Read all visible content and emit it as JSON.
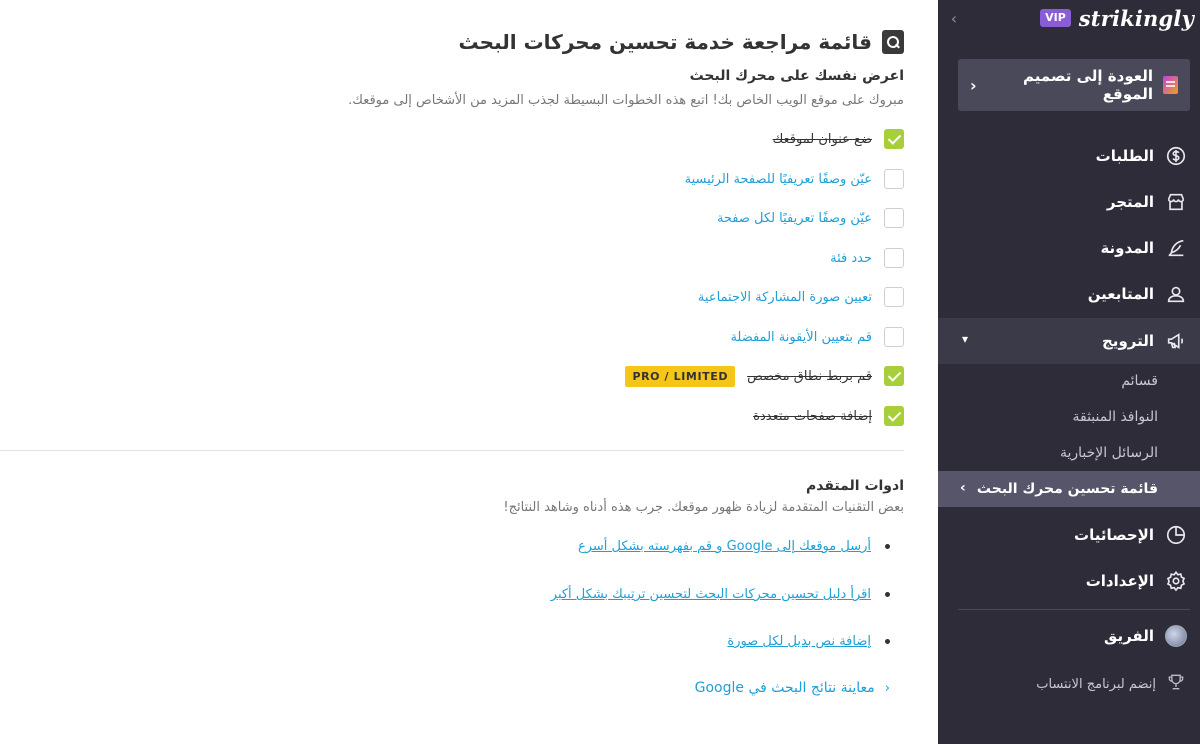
{
  "brand": {
    "vip": "VIP",
    "logo": "strikingly"
  },
  "sidebar": {
    "back_label": "العودة إلى تصميم الموقع",
    "items": [
      {
        "label": "الطلبات",
        "icon": "dollar-icon"
      },
      {
        "label": "المتجر",
        "icon": "store-icon"
      },
      {
        "label": "المدونة",
        "icon": "quill-icon"
      },
      {
        "label": "المتابعين",
        "icon": "followers-icon"
      },
      {
        "label": "الترويج",
        "icon": "megaphone-icon"
      }
    ],
    "sub_items": [
      {
        "label": "قسائم"
      },
      {
        "label": "النوافذ المنبثقة"
      },
      {
        "label": "الرسائل الإخبارية"
      },
      {
        "label": "قائمة تحسين محرك البحث",
        "active": true
      }
    ],
    "items2": [
      {
        "label": "الإحصائيات",
        "icon": "pie-chart-icon"
      },
      {
        "label": "الإعدادات",
        "icon": "gear-icon"
      }
    ],
    "team_label": "الفريق",
    "affiliate_label": "إنضم لبرنامج الانتساب"
  },
  "main": {
    "title": "قائمة مراجعة خدمة تحسين محركات البحث",
    "section1": {
      "heading": "اعرض نفسك على محرك البحث",
      "subtitle": "مبروك على موقع الويب الخاص بك! اتبع هذه الخطوات البسيطة لجذب المزيد من الأشخاص إلى موقعك."
    },
    "checklist": [
      {
        "label": "ضع عنوان لموقعك",
        "checked": true
      },
      {
        "label": "عيّن وصفًا تعريفيًا للصفحة الرئيسية",
        "checked": false
      },
      {
        "label": "عيّن وصفًا تعريفيًا لكل صفحة",
        "checked": false
      },
      {
        "label": "حدد فئة",
        "checked": false
      },
      {
        "label": "تعيين صورة المشاركة الاجتماعية",
        "checked": false
      },
      {
        "label": "قم بتعيين الأيقونة المفضلة",
        "checked": false
      },
      {
        "label": "قم بربط نطاق مخصص",
        "checked": true,
        "badge": "PRO / LIMITED"
      },
      {
        "label": "إضافة صفحات متعددة",
        "checked": true
      }
    ],
    "section2": {
      "heading": "ادوات المتقدم",
      "subtitle": "بعض التقنيات المتقدمة لزيادة ظهور موقعك. جرب هذه أدناه وشاهد النتائج!"
    },
    "tools": [
      {
        "label": "أرسل موقعك إلى Google و قم بفهرسته بشكل أسرع"
      },
      {
        "label": "اقرأ دليل تحسين محركات البحث لتحسين ترتيبك بشكل أكبر"
      },
      {
        "label": "إضافة نص بديل لكل صورة"
      }
    ],
    "preview_label": "معاينة نتائج البحث في Google"
  },
  "colors": {
    "sidebar_bg": "#2d2c38",
    "accent_green": "#a6cf39",
    "link_blue": "#1e9fd8",
    "badge_yellow": "#f5c518",
    "vip_purple": "#8a5cd6"
  }
}
